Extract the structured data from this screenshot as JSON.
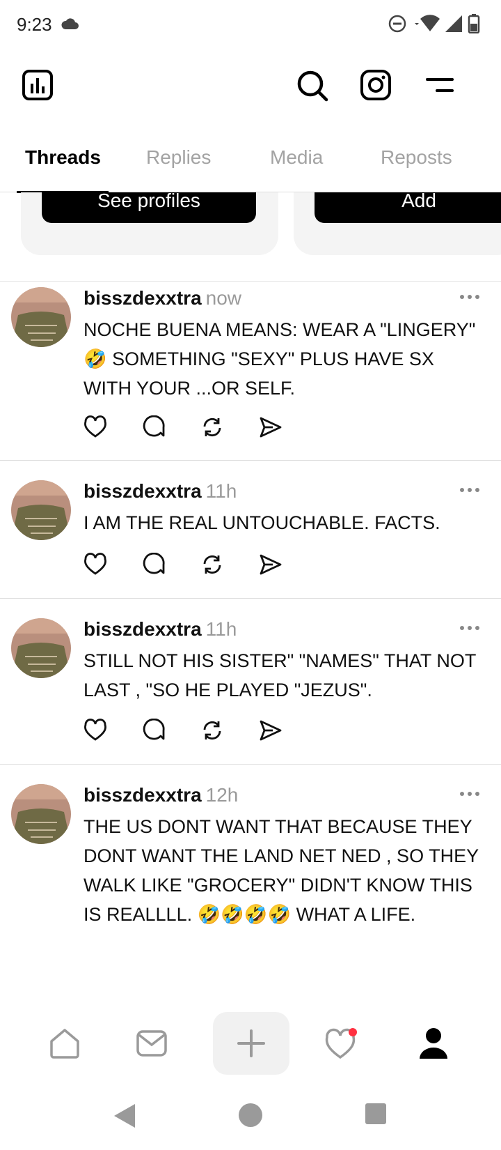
{
  "status_bar": {
    "time": "9:23"
  },
  "tabs": [
    {
      "label": "Threads",
      "active": true
    },
    {
      "label": "Replies",
      "active": false
    },
    {
      "label": "Media",
      "active": false
    },
    {
      "label": "Reposts",
      "active": false
    }
  ],
  "cards": {
    "see_profiles": "See profiles",
    "add": "Add"
  },
  "posts": [
    {
      "username": "bisszdexxtra",
      "time": "now",
      "text": "NOCHE BUENA MEANS: WEAR A \"LINGERY\" 🤣 SOMETHING \"SEXY\" PLUS HAVE SX WITH YOUR ...OR SELF."
    },
    {
      "username": "bisszdexxtra",
      "time": "11h",
      "text": "I AM THE REAL UNTOUCHABLE. FACTS."
    },
    {
      "username": "bisszdexxtra",
      "time": "11h",
      "text": "STILL NOT HIS SISTER\" \"NAMES\" THAT NOT LAST , \"SO HE PLAYED \"JEZUS\"."
    },
    {
      "username": "bisszdexxtra",
      "time": "12h",
      "text": "THE US DONT WANT THAT BECAUSE THEY DONT WANT THE LAND NET NED , SO THEY WALK LIKE \"GROCERY\"  DIDN'T KNOW THIS IS REALLLL. 🤣🤣🤣🤣 WHAT A LIFE."
    }
  ],
  "icons": {
    "insights": "insights-icon",
    "search": "search-icon",
    "instagram": "instagram-icon",
    "menu": "menu-icon",
    "home": "home-icon",
    "inbox": "inbox-icon",
    "new_thread": "plus-icon",
    "activity": "heart-icon",
    "profile": "profile-icon"
  },
  "colors": {
    "accent": "#000000",
    "muted": "#a3a3a3",
    "notification_dot": "#ff3040"
  }
}
